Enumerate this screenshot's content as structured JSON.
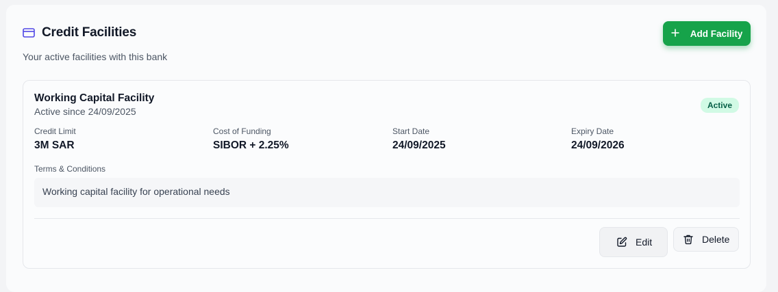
{
  "header": {
    "title": "Credit Facilities",
    "subtitle": "Your active facilities with this bank",
    "add_button_label": "Add Facility",
    "icons": {
      "title": "credit-card-icon",
      "add": "plus-icon"
    }
  },
  "facility": {
    "name": "Working Capital Facility",
    "since": "Active since 24/09/2025",
    "status": "Active",
    "fields": [
      {
        "label": "Credit Limit",
        "value": "3M SAR"
      },
      {
        "label": "Cost of Funding",
        "value": "SIBOR + 2.25%"
      },
      {
        "label": "Start Date",
        "value": "24/09/2025"
      },
      {
        "label": "Expiry Date",
        "value": "24/09/2026"
      }
    ],
    "terms_label": "Terms & Conditions",
    "terms_text": "Working capital facility for operational needs",
    "actions": {
      "edit_label": "Edit",
      "delete_label": "Delete",
      "edit_icon": "edit-icon",
      "delete_icon": "trash-icon"
    }
  },
  "colors": {
    "accent_green": "#16a34a",
    "badge_bg": "#d1fae5",
    "badge_text": "#065f46",
    "title_icon": "#4f46e5"
  }
}
